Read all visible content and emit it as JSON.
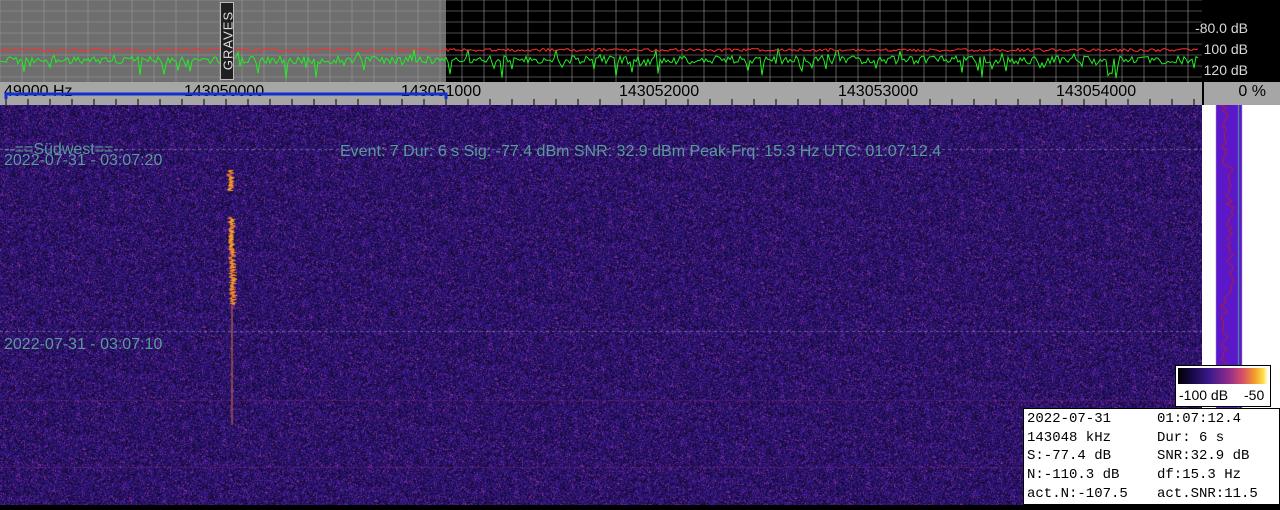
{
  "spectrum": {
    "db_labels": [
      "-80.0 dB",
      "100 dB",
      "120 dB"
    ],
    "marker_label": "GRAVES"
  },
  "freq_axis": {
    "labels": [
      "49000 Hz",
      "143050000",
      "143051000",
      "143052000",
      "143053000",
      "143054000"
    ],
    "percent": "0 %"
  },
  "waterfall": {
    "station": "--==Südwest==--",
    "timestamps": [
      "2022-07-31 - 03:07:20",
      "2022-07-31 - 03:07:10"
    ],
    "event_line": "Event: 7   Dur: 6 s   Sig: -77.4 dBm   SNR: 32.9 dBm   Peak-Frq: 15.3 Hz   UTC: 01:07:12.4"
  },
  "colorbar": {
    "min_label": "-100 dB",
    "max_label": "-50"
  },
  "info": {
    "rows": [
      [
        "2022-07-31",
        "01:07:12.4"
      ],
      [
        "143048 kHz",
        "Dur: 6 s"
      ],
      [
        "S:-77.4 dB",
        "SNR:32.9 dB"
      ],
      [
        "N:-110.3 dB",
        "df:15.3 Hz"
      ],
      [
        "act.N:-107.5",
        "act.SNR:11.5"
      ]
    ]
  },
  "colors": {
    "waterfall_bg": "#2a1468",
    "signal": "#f0a030",
    "spectrum_trace": "#22ee22",
    "spectrum_peak": "#ff3030",
    "selection": "#1030d0"
  }
}
